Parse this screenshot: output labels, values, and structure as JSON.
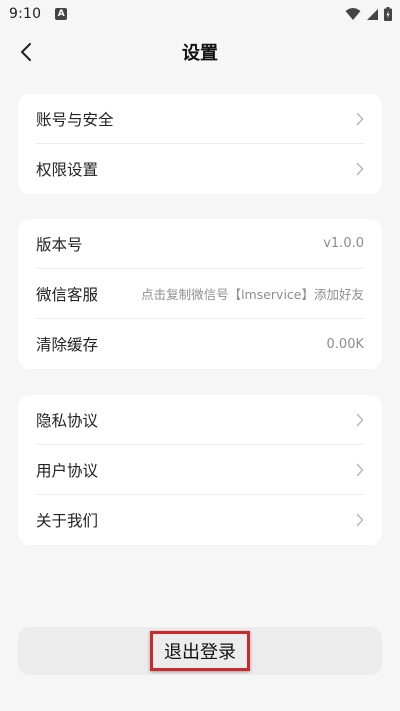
{
  "status_bar": {
    "time": "9:10",
    "notification_glyph": "A"
  },
  "header": {
    "title": "设置"
  },
  "account_group": [
    {
      "label": "账号与安全"
    },
    {
      "label": "权限设置"
    }
  ],
  "info_group": {
    "version": {
      "label": "版本号",
      "value": "v1.0.0"
    },
    "wechat": {
      "label": "微信客服",
      "value": "点击复制微信号【lmservice】添加好友"
    },
    "cache": {
      "label": "清除缓存",
      "value": "0.00K"
    }
  },
  "legal_group": [
    {
      "label": "隐私协议"
    },
    {
      "label": "用户协议"
    },
    {
      "label": "关于我们"
    }
  ],
  "logout_label": "退出登录"
}
